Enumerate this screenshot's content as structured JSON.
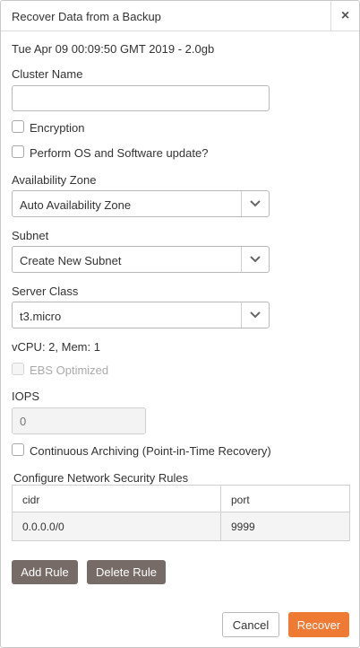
{
  "dialog": {
    "title": "Recover Data from a Backup",
    "close_label": "×"
  },
  "backup_info": "Tue Apr 09 00:09:50 GMT 2019 - 2.0gb",
  "cluster_name": {
    "label": "Cluster Name",
    "value": ""
  },
  "encryption": {
    "label": "Encryption",
    "checked": false
  },
  "os_update": {
    "label": "Perform OS and Software update?",
    "checked": false
  },
  "availability_zone": {
    "label": "Availability Zone",
    "selected": "Auto Availability Zone"
  },
  "subnet": {
    "label": "Subnet",
    "selected": "Create New Subnet"
  },
  "server_class": {
    "label": "Server Class",
    "selected": "t3.micro"
  },
  "server_specs": "vCPU: 2, Mem: 1",
  "ebs_optimized": {
    "label": "EBS Optimized",
    "checked": false,
    "disabled": true
  },
  "iops": {
    "label": "IOPS",
    "placeholder": "0"
  },
  "continuous_archiving": {
    "label": "Continuous Archiving (Point-in-Time Recovery)",
    "checked": false
  },
  "security_rules": {
    "label": "Configure Network Security Rules",
    "columns": [
      "cidr",
      "port"
    ],
    "rows": [
      [
        "0.0.0.0/0",
        "9999"
      ]
    ]
  },
  "buttons": {
    "add_rule": "Add Rule",
    "delete_rule": "Delete Rule",
    "cancel": "Cancel",
    "recover": "Recover"
  },
  "colors": {
    "primary": "#ef7a33",
    "secondary": "#766b66"
  },
  "icons": {
    "close": "close-icon",
    "dropdown": "chevron-down-icon"
  }
}
